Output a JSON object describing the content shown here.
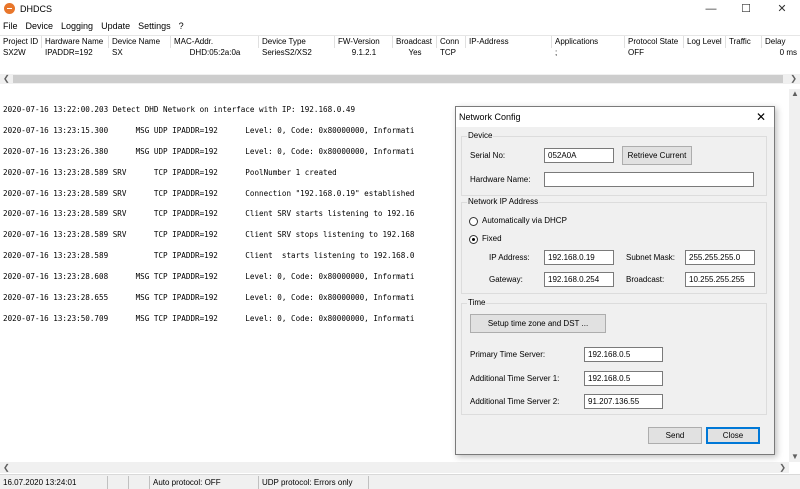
{
  "window": {
    "title": "DHDCS",
    "minimize": "—",
    "maximize": "☐",
    "close": "✕"
  },
  "menu": [
    "File",
    "Device",
    "Logging",
    "Update",
    "Settings",
    "?"
  ],
  "table": {
    "columns": [
      "Project ID",
      "Hardware Name",
      "Device Name",
      "MAC-Addr.",
      "Device Type",
      "FW-Version",
      "Broadcast",
      "Conn",
      "IP-Address",
      "Applications",
      "Protocol State",
      "Log Level",
      "Traffic",
      "Delay"
    ],
    "rows": [
      [
        "SX2W",
        "IPADDR=192",
        "SX",
        "DHD:05:2a:0a",
        "SeriesS2/XS2",
        "9.1.2.1",
        "Yes",
        "TCP",
        "",
        ";",
        "OFF",
        "",
        "",
        "0 ms"
      ]
    ]
  },
  "log": [
    "2020-07-16 13:22:00.203 Detect DHD Network on interface with IP: 192.168.0.49",
    "2020-07-16 13:23:15.300      MSG UDP IPADDR=192      Level: 0, Code: 0x80000000, Informati",
    "2020-07-16 13:23:26.380      MSG UDP IPADDR=192      Level: 0, Code: 0x80000000, Informati",
    "2020-07-16 13:23:28.589 SRV      TCP IPADDR=192      PoolNumber 1 created",
    "2020-07-16 13:23:28.589 SRV      TCP IPADDR=192      Connection \"192.168.0.19\" established",
    "2020-07-16 13:23:28.589 SRV      TCP IPADDR=192      Client SRV starts listening to 192.16",
    "2020-07-16 13:23:28.589 SRV      TCP IPADDR=192      Client SRV stops listening to 192.168",
    "2020-07-16 13:23:28.589          TCP IPADDR=192      Client  starts listening to 192.168.0",
    "2020-07-16 13:23:28.608      MSG TCP IPADDR=192      Level: 0, Code: 0x80000000, Informati",
    "2020-07-16 13:23:28.655      MSG TCP IPADDR=192      Level: 0, Code: 0x80000000, Informati",
    "2020-07-16 13:23:50.709      MSG TCP IPADDR=192      Level: 0, Code: 0x80000000, Informati"
  ],
  "status": {
    "datetime": "16.07.2020 13:24:01",
    "auto_protocol": "Auto protocol: OFF",
    "udp_protocol": "UDP protocol: Errors only"
  },
  "dialog": {
    "title": "Network Config",
    "device": {
      "group_label": "Device",
      "serial_label": "Serial No:",
      "serial_value": "052A0A",
      "retrieve_button": "Retrieve Current",
      "hardware_label": "Hardware Name:",
      "hardware_value": ""
    },
    "network": {
      "group_label": "Network IP Address",
      "dhcp_label": "Automatically via DHCP",
      "dhcp_selected": false,
      "fixed_label": "Fixed",
      "fixed_selected": true,
      "ip_label": "IP Address:",
      "ip_value": "192.168.0.19",
      "mask_label": "Subnet Mask:",
      "mask_value": "255.255.255.0",
      "gateway_label": "Gateway:",
      "gateway_value": "192.168.0.254",
      "broadcast_label": "Broadcast:",
      "broadcast_value": "10.255.255.255"
    },
    "time": {
      "group_label": "Time",
      "setup_button": "Setup time zone and DST ...",
      "primary_label": "Primary Time Server:",
      "primary_value": "192.168.0.5",
      "additional1_label": "Additional Time Server 1:",
      "additional1_value": "192.168.0.5",
      "additional2_label": "Additional Time Server 2:",
      "additional2_value": "91.207.136.55"
    },
    "send_button": "Send",
    "close_button": "Close"
  }
}
